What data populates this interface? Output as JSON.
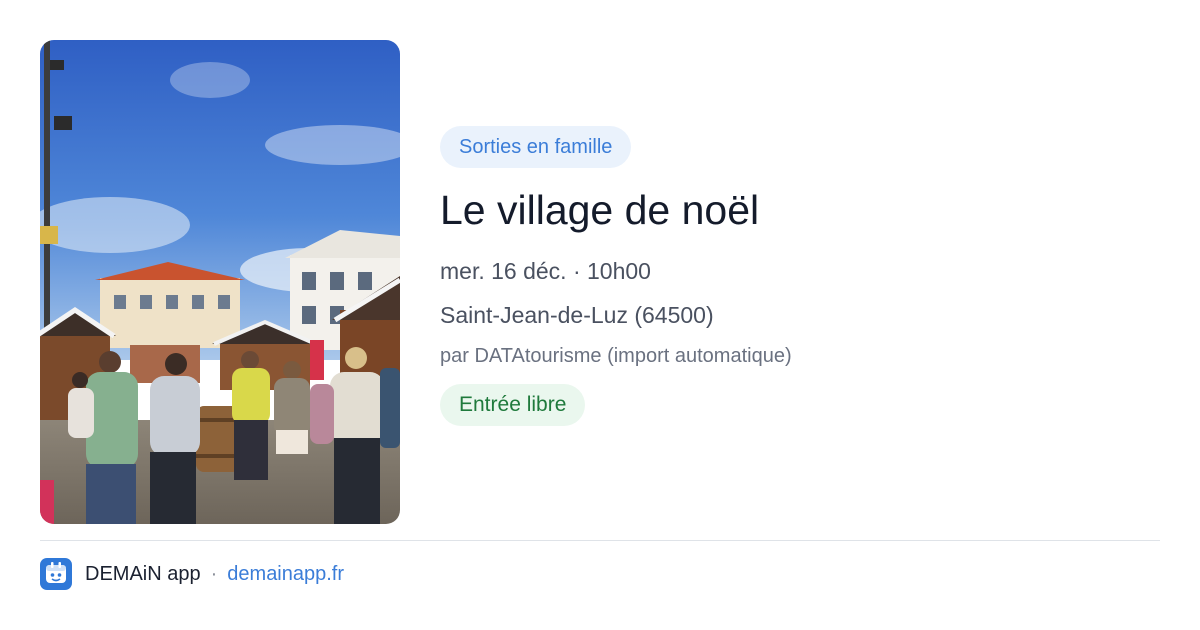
{
  "event": {
    "photo_icon": "christmas-market-photo",
    "category": "Sorties en famille",
    "title": "Le village de noël",
    "datetime": "mer. 16 déc. · 10h00",
    "location": "Saint-Jean-de-Luz (64500)",
    "author": "par DATAtourisme (import automatique)",
    "price": "Entrée libre"
  },
  "footer": {
    "app_icon": "demain-app-logo",
    "app_name": "DEMAiN app",
    "separator": "·",
    "website": "demainapp.fr"
  },
  "colors": {
    "accent": "#3b7dd8",
    "category_bg": "#eaf2fc",
    "price_text": "#1f7a3c",
    "price_bg": "#eaf7ee",
    "title": "#141b2b"
  }
}
